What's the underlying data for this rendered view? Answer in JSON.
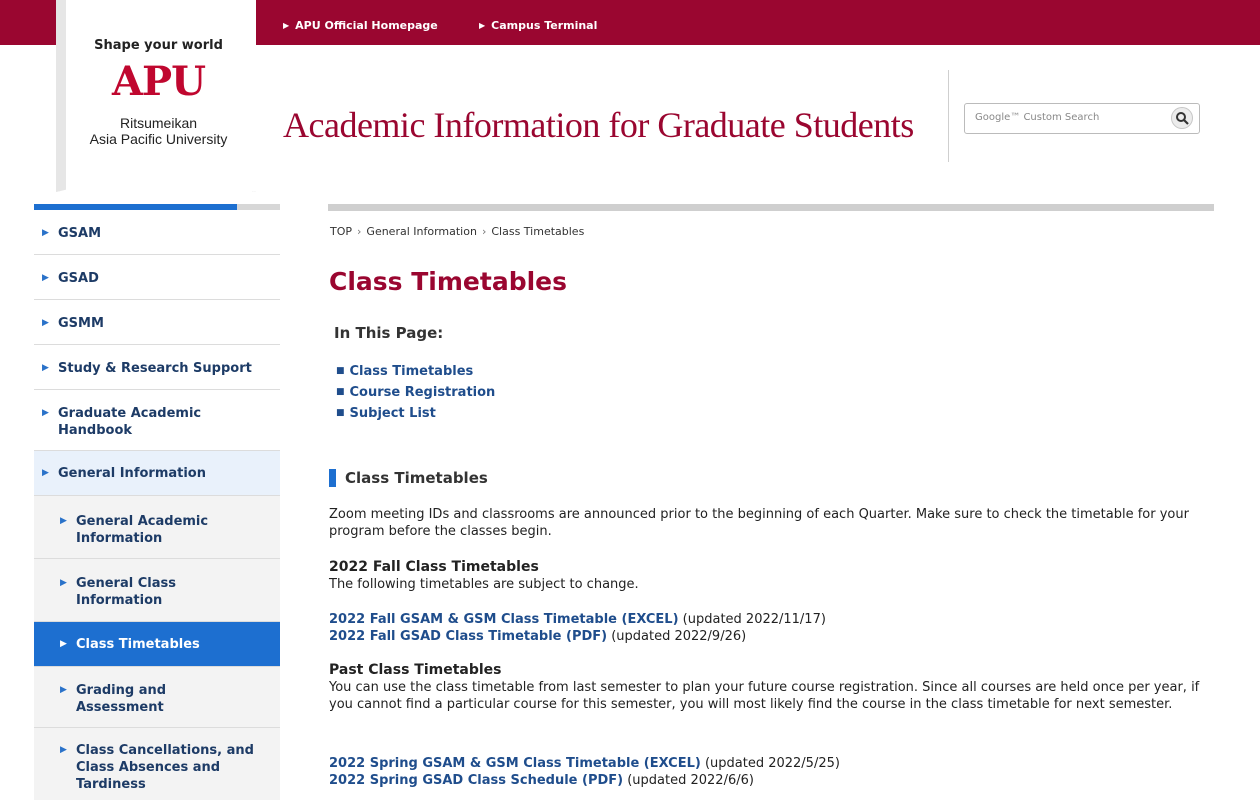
{
  "topbar": {
    "links": [
      "APU Official Homepage",
      "Campus Terminal"
    ]
  },
  "logo": {
    "tagline": "Shape your world",
    "mark": "APU",
    "university_line1": "Ritsumeikan",
    "university_line2": "Asia Pacific University"
  },
  "header": {
    "site_title": "Academic Information for Graduate Students",
    "search_placeholder": "Google™ Custom Search"
  },
  "sidebar": {
    "items": [
      {
        "label": "GSAM"
      },
      {
        "label": "GSAD"
      },
      {
        "label": "GSMM"
      },
      {
        "label": "Study & Research Support"
      },
      {
        "label": "Graduate Academic Handbook"
      },
      {
        "label": "General Information"
      },
      {
        "label": "General Academic Information"
      },
      {
        "label": "General Class Information"
      },
      {
        "label": "Class Timetables"
      },
      {
        "label": "Grading and Assessment"
      },
      {
        "label": "Class Cancellations, and Class Absences and Tardiness"
      }
    ]
  },
  "breadcrumb": [
    "TOP",
    "General Information",
    "Class Timetables"
  ],
  "main": {
    "title": "Class Timetables",
    "in_this_page": {
      "title": "In This Page:",
      "items": [
        "Class Timetables",
        "Course Registration",
        "Subject List"
      ]
    },
    "section": {
      "heading": "Class Timetables",
      "intro": "Zoom meeting IDs and classrooms are announced prior to the beginning of each Quarter. Make sure to check the timetable for your program before the classes begin.",
      "fall": {
        "heading": "2022 Fall Class Timetables",
        "note": "The following timetables are subject to change.",
        "links": [
          {
            "label": "2022 Fall GSAM & GSM Class Timetable (EXCEL)",
            "note": " (updated 2022/11/17)"
          },
          {
            "label": "2022 Fall GSAD Class Timetable (PDF)",
            "note": " (updated 2022/9/26)"
          }
        ]
      },
      "past": {
        "heading": "Past Class Timetables",
        "text": "You can use the class timetable from last semester to plan your future course registration. Since all courses are held once per year, if you cannot find a particular course for this semester, you will most likely find the course in the class timetable for next semester.",
        "links": [
          {
            "label": "2022 Spring GSAM & GSM Class Timetable (EXCEL)",
            "note": " (updated 2022/5/25)"
          },
          {
            "label": "2022 Spring GSAD Class Schedule (PDF)",
            "note": " (updated 2022/6/6)"
          }
        ]
      }
    }
  },
  "colors": {
    "brand": "#9a0630",
    "accent": "#1d6fd0",
    "link": "#1f4d8c"
  }
}
